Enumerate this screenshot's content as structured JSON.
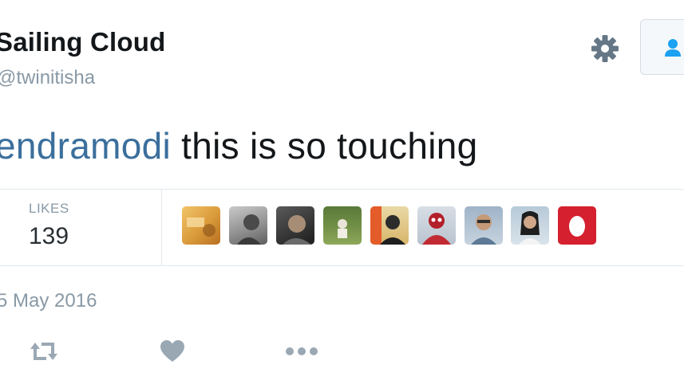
{
  "user": {
    "display_name": "Sailing Cloud",
    "handle": "@twinitisha"
  },
  "tweet": {
    "mention": "endramodi",
    "text": " this is so touching",
    "timestamp": "5 May 2016"
  },
  "stats": {
    "likes_label": "LIKES",
    "likes_count": "139"
  },
  "colors": {
    "mention": "#3b6f9c",
    "muted": "#8899a6",
    "icon": "#8899a6",
    "follow_icon": "#1da1f2"
  },
  "icons": {
    "settings": "gear-icon",
    "follow": "follow-user-icon",
    "retweet": "retweet-icon",
    "like": "heart-icon",
    "more": "more-icon"
  }
}
